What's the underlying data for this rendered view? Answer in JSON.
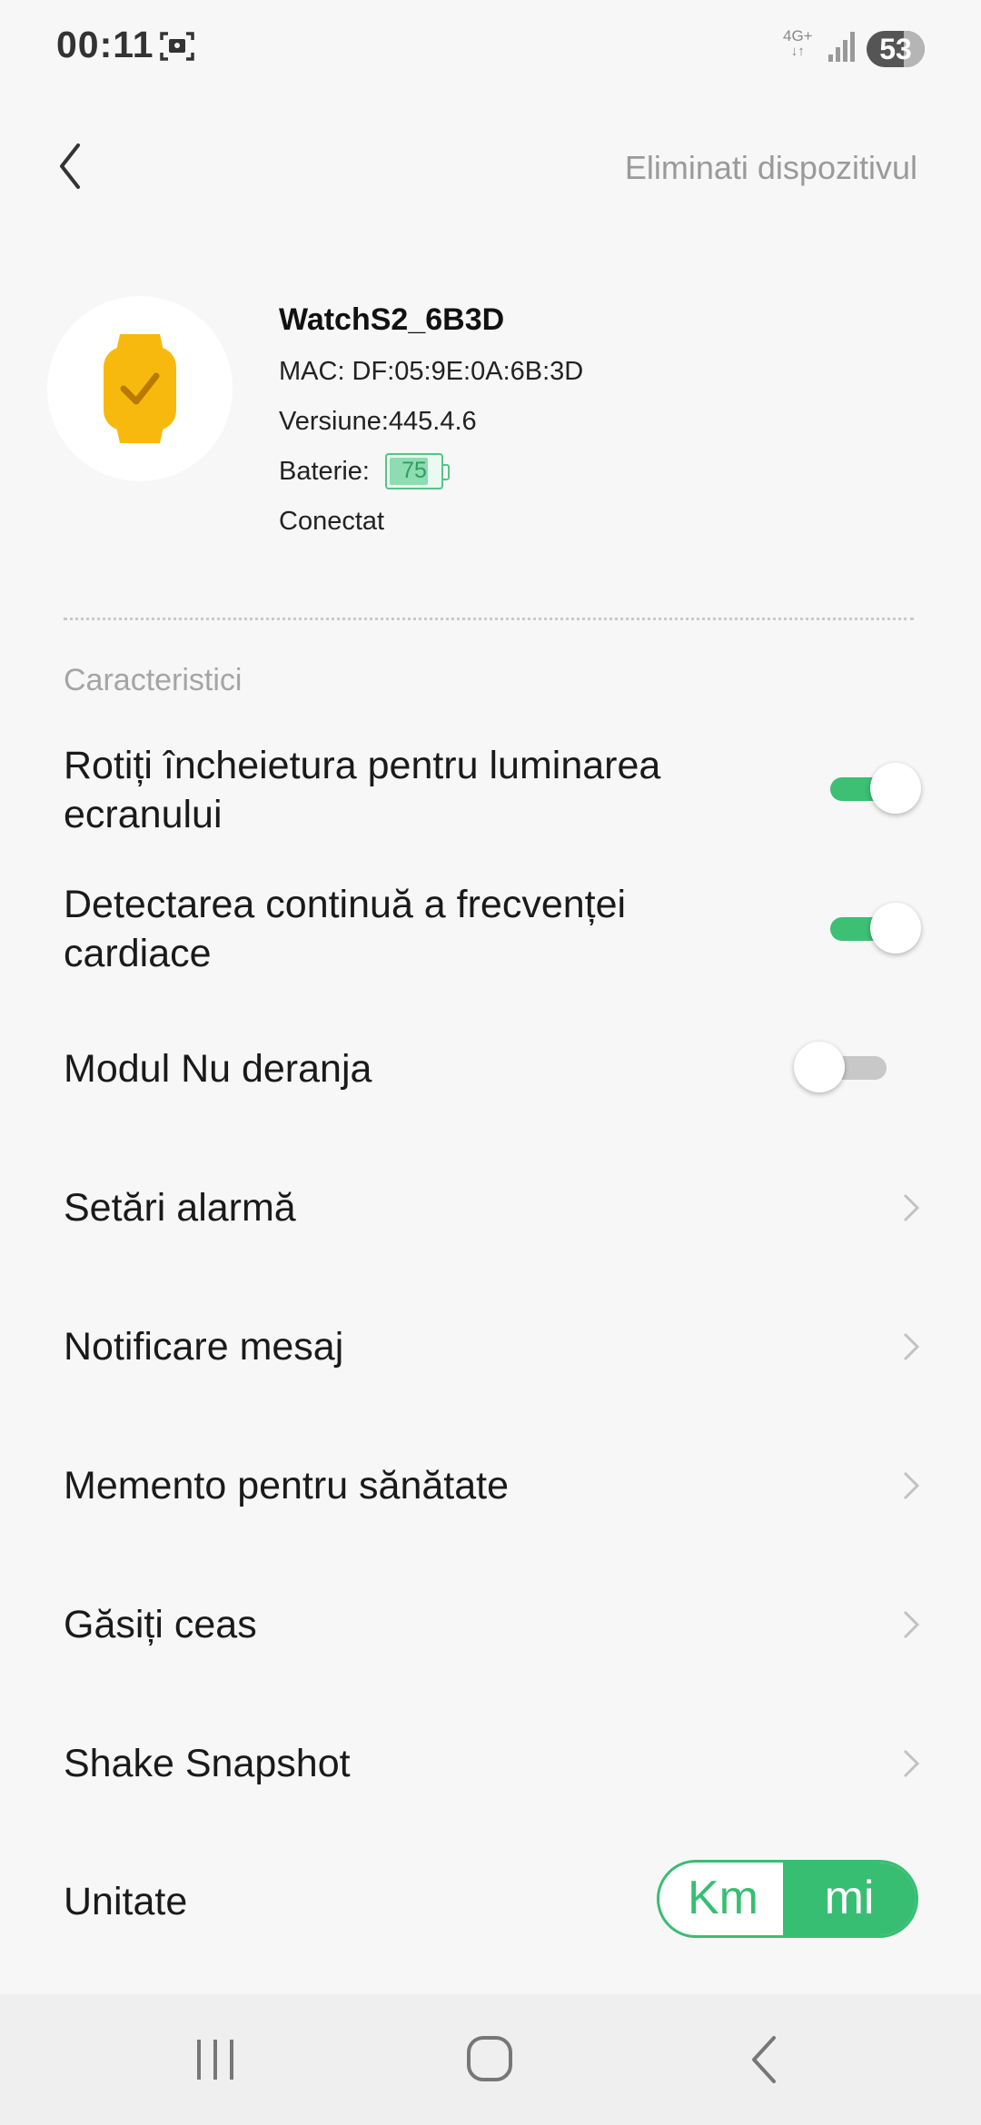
{
  "status_bar": {
    "time": "00:11",
    "network": "4G+",
    "battery": "53"
  },
  "header": {
    "remove_device": "Eliminati dispozitivul"
  },
  "device": {
    "name": "WatchS2_6B3D",
    "mac": "MAC: DF:05:9E:0A:6B:3D",
    "version": "Versiune:445.4.6",
    "battery_label": "Baterie:",
    "battery_level": "75",
    "status": "Conectat"
  },
  "section_label": "Caracteristici",
  "settings": {
    "wrist_wake": {
      "label": "Rotiți încheietura pentru luminarea ecranului",
      "enabled": true
    },
    "heart_rate": {
      "label": "Detectarea continuă a frecvenței cardiace",
      "enabled": true
    },
    "do_not_disturb": {
      "label": "Modul Nu deranja",
      "enabled": false
    },
    "alarm": {
      "label": "Setări alarmă"
    },
    "message_notification": {
      "label": "Notificare mesaj"
    },
    "health_reminder": {
      "label": "Memento pentru sănătate"
    },
    "find_watch": {
      "label": "Găsiți ceas"
    },
    "shake_snapshot": {
      "label": "Shake Snapshot"
    },
    "unit": {
      "label": "Unitate",
      "options": [
        "Km",
        "mi"
      ],
      "selected": "mi"
    }
  },
  "colors": {
    "accent": "#3dbf74",
    "watch_icon": "#f8b90f",
    "muted_text": "#9a9a9a"
  },
  "icons": {
    "back": "chevron-left-icon",
    "row_arrow": "chevron-right-icon",
    "device": "smartwatch-icon"
  }
}
